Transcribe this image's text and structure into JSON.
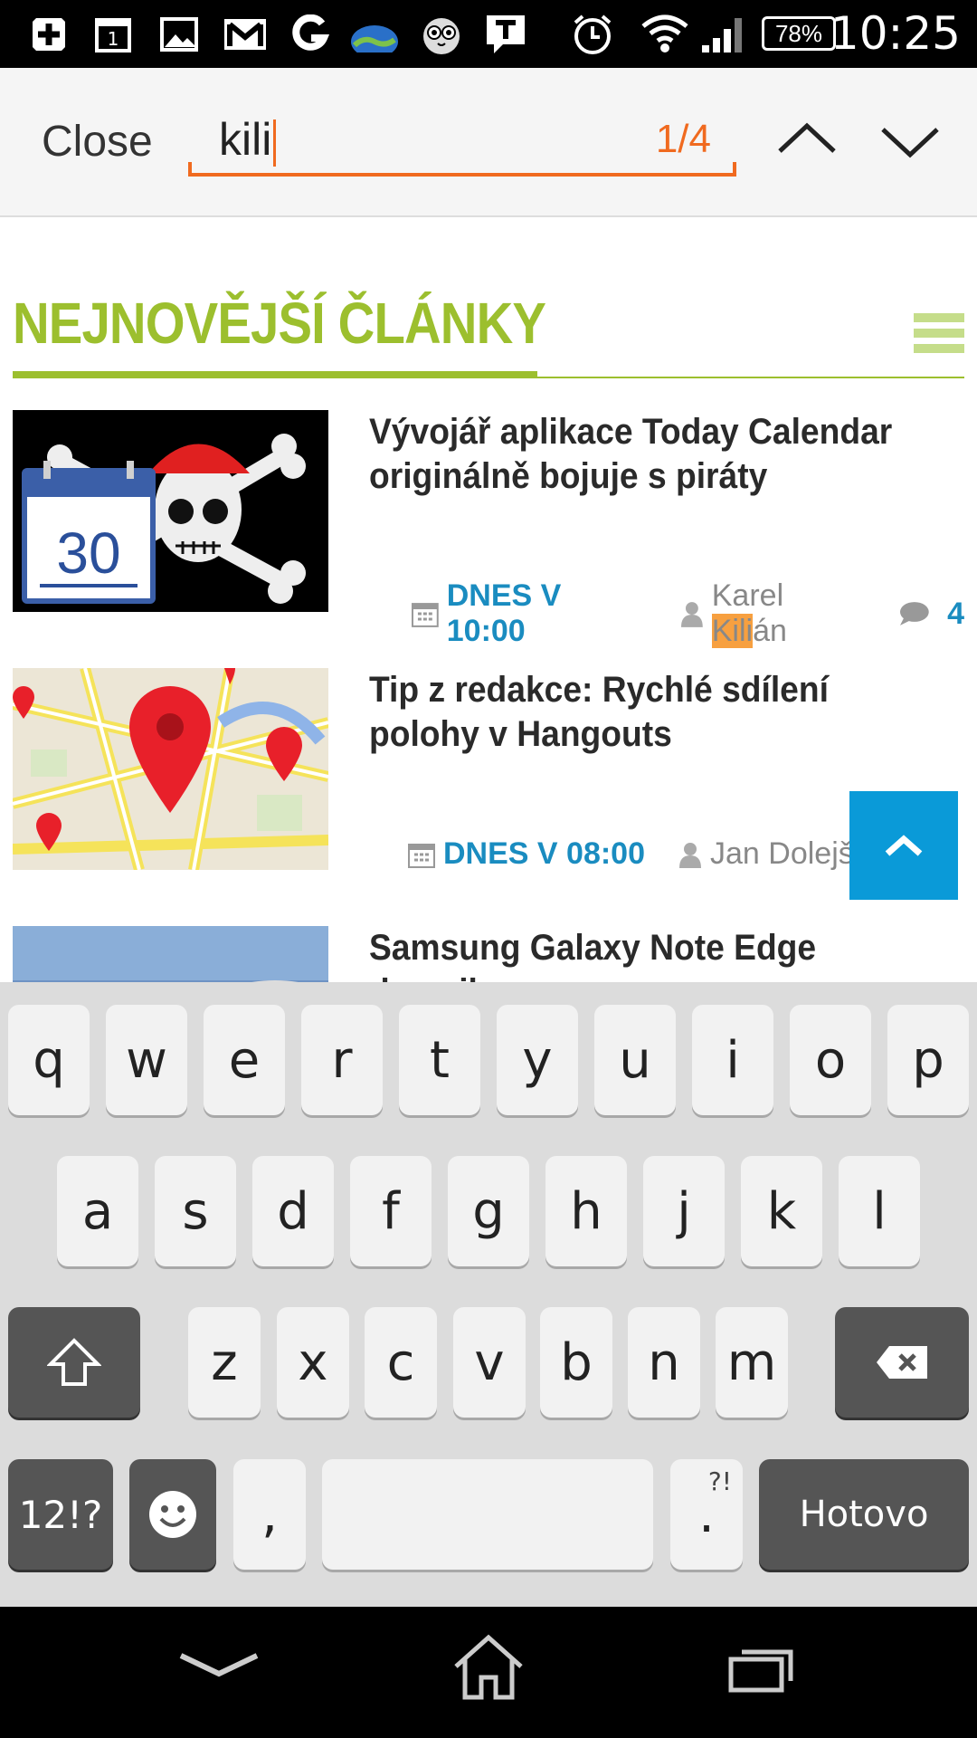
{
  "status_bar": {
    "time": "10:25",
    "battery": "78%",
    "icons": [
      "plus-notification-icon",
      "calendar-icon",
      "image-icon",
      "gmail-icon",
      "g-app-icon",
      "weather-globe-icon",
      "owl-app-icon",
      "t-message-icon",
      "alarm-icon",
      "wifi-icon",
      "signal-icon"
    ],
    "calendar_day": "1"
  },
  "find_bar": {
    "close_label": "Close",
    "query": "kili",
    "match_count": "1/4",
    "accent_color": "#f06a1f"
  },
  "section": {
    "title": "NEJNOVĚJŠÍ ČLÁNKY",
    "accent_color": "#9cbf2e"
  },
  "articles": [
    {
      "title": "Vývojář aplikace Today Calendar originálně bojuje s piráty",
      "date": "DNES V 10:00",
      "author_before": "Karel ",
      "author_highlight": "Kili",
      "author_after": "án",
      "comments": "4",
      "thumb_label": "30"
    },
    {
      "title": "Tip z redakce: Rychlé sdílení polohy v Hangouts",
      "date": "DNES V 08:00",
      "author": "Jan Dolejš"
    },
    {
      "title": "Samsung Galaxy Note Edge dorazil"
    }
  ],
  "keyboard": {
    "row1": [
      "q",
      "w",
      "e",
      "r",
      "t",
      "y",
      "u",
      "i",
      "o",
      "p"
    ],
    "row2": [
      "a",
      "s",
      "d",
      "f",
      "g",
      "h",
      "j",
      "k",
      "l"
    ],
    "row3": [
      "z",
      "x",
      "c",
      "v",
      "b",
      "n",
      "m"
    ],
    "symbols_label": "12!?",
    "comma_label": ",",
    "period_label": ".",
    "period_hint": "?!",
    "done_label": "Hotovo"
  }
}
